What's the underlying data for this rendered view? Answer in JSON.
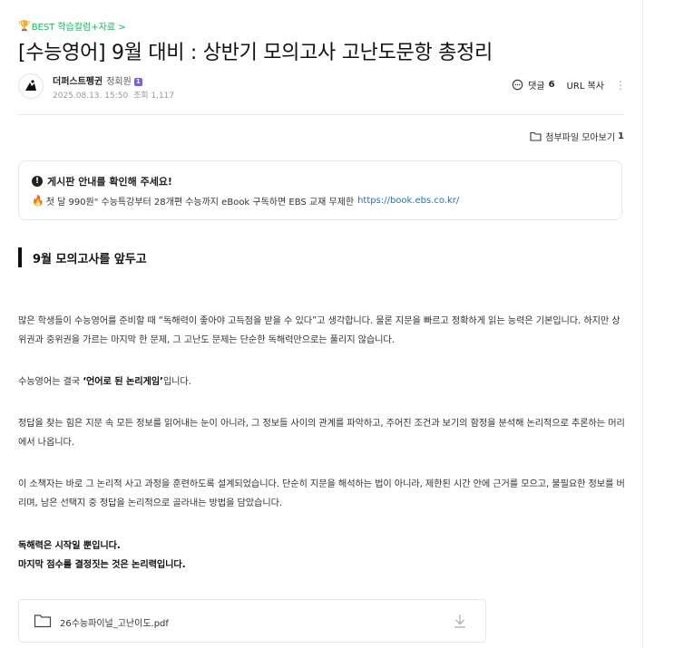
{
  "category": {
    "label": "BEST 학습칼럼+자료 >"
  },
  "post": {
    "title": "[수능영어] 9월 대비 : 상반기 모의고사 고난도문항 총정리",
    "author": "더퍼스트펭귄",
    "grade": "정회원",
    "grade_badge": "1",
    "date": "2025.08.13. 15:50",
    "views_label": "조회 1,117"
  },
  "actions": {
    "comments_label": "댓글",
    "comments_count": "6",
    "url_copy_label": "URL 복사"
  },
  "attachments": {
    "label": "첨부파일 모아보기",
    "count": "1"
  },
  "notice": {
    "title": "게시판 안내를 확인해 주세요!",
    "body": "첫 달 990원\" 수능특강부터 28개편 수능까지 eBook 구독하면 EBS 교재 무제한",
    "link": "https://book.ebs.co.kr/"
  },
  "section": {
    "heading": "9월 모의고사를 앞두고"
  },
  "paragraphs": {
    "p1": "많은 학생들이 수능영어를 준비할 때 “독해력이 좋아야 고득점을 받을 수 있다”고 생각합니다. 물론 지문을 빠르고 정확하게 읽는 능력은 기본입니다. 하지만 상위권과 중위권을 가르는 마지막 한 문제, 그 고난도 문제는 단순한 독해력만으로는 풀리지 않습니다.",
    "p2_pre": "수능영어는 결국 ",
    "p2_bold": "‘언어로 된 논리게임’",
    "p2_post": "입니다.",
    "p3": "정답을 찾는 힘은 지문 속 모든 정보를 읽어내는 눈이 아니라, 그 정보들 사이의 관계를 파악하고, 주어진 조건과 보기의 함정을 분석해 논리적으로 추론하는 머리에서 나옵니다.",
    "p4": "이 소책자는 바로 그 논리적 사고 과정을 훈련하도록 설계되었습니다. 단순히 지문을 해석하는 법이 아니라, 제한된 시간 안에 근거를 모으고, 불필요한 정보를 버리며, 남은 선택지 중 정답을 논리적으로 골라내는 방법을 담았습니다.",
    "p5_line1": "독해력은 시작일 뿐입니다.",
    "p5_line2": "마지막 점수를 결정짓는 것은 논리력입니다."
  },
  "file": {
    "name": "26수능파이널_고난이도.pdf"
  },
  "icons": {
    "trophy": "trophy-icon",
    "comment": "comment-bubble-icon",
    "more": "vertical-more-icon",
    "folder": "folder-icon",
    "info": "info-circle-icon",
    "fire": "fire-icon",
    "download": "download-icon"
  },
  "colors": {
    "accent_green": "#03c75a",
    "link_blue": "#1f6fd6",
    "badge_purple": "#7a5de8"
  }
}
